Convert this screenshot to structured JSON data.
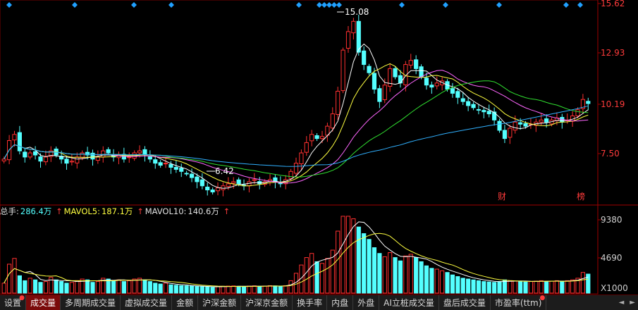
{
  "price_axis": {
    "labels": [
      "15.62",
      "12.93",
      "10.19",
      "7.50"
    ],
    "values": [
      15.62,
      12.93,
      10.19,
      7.5
    ]
  },
  "volume_axis": {
    "labels": [
      "9380",
      "4690",
      "X1000"
    ],
    "values": [
      9380,
      4690
    ]
  },
  "annotations": {
    "high": "15.08",
    "low": "6.42",
    "marker_cai": "财",
    "marker_bang": "榜"
  },
  "legend": {
    "total_label": "总手:",
    "total_value": "286.4万",
    "mavol5_label": "MAVOL5:",
    "mavol5_value": "187.1万",
    "mavol10_label": "MAVOL10:",
    "mavol10_value": "140.6万",
    "arrow": "↑"
  },
  "tabs": [
    {
      "label": "设置",
      "dot": true,
      "active": false
    },
    {
      "label": "成交量",
      "dot": false,
      "active": true
    },
    {
      "label": "多周期成交量",
      "dot": false,
      "active": false
    },
    {
      "label": "虚拟成交量",
      "dot": false,
      "active": false
    },
    {
      "label": "金额",
      "dot": false,
      "active": false
    },
    {
      "label": "沪深金额",
      "dot": false,
      "active": false
    },
    {
      "label": "沪深京金额",
      "dot": false,
      "active": false
    },
    {
      "label": "换手率",
      "dot": false,
      "active": false
    },
    {
      "label": "内盘",
      "dot": false,
      "active": false
    },
    {
      "label": "外盘",
      "dot": false,
      "active": false
    },
    {
      "label": "AI立桩成交量",
      "dot": false,
      "active": false
    },
    {
      "label": "盘后成交量",
      "dot": false,
      "active": false
    },
    {
      "label": "市盈率(ttm)",
      "dot": true,
      "active": false
    }
  ],
  "nav": {
    "left": "◄",
    "right": "►"
  },
  "colors": {
    "up": "#ff3030",
    "down": "#54ffff",
    "ma5": "#ffffff",
    "ma10": "#ffff40",
    "ma20": "#ff66ff",
    "ma30": "#30e030",
    "ma60": "#30b0ff",
    "marker": "#20a0ff"
  },
  "chart_data": {
    "type": "candlestick",
    "ohlc_closes": [
      8.2,
      9.1,
      9.4,
      8.6,
      8.3,
      8.5,
      8.4,
      8.1,
      8.3,
      8.6,
      8.4,
      8.2,
      8.0,
      8.1,
      8.3,
      8.5,
      8.4,
      8.2,
      8.3,
      8.6,
      8.5,
      8.3,
      8.4,
      8.2,
      8.3,
      8.5,
      8.6,
      8.4,
      8.2,
      8.0,
      7.9,
      8.0,
      7.8,
      7.7,
      7.6,
      7.5,
      7.3,
      7.1,
      6.9,
      6.7,
      6.6,
      6.8,
      6.9,
      7.0,
      7.1,
      7.0,
      6.9,
      7.1,
      7.2,
      7.0,
      7.1,
      7.2,
      7.1,
      7.0,
      7.2,
      7.6,
      8.0,
      8.5,
      9.0,
      9.4,
      9.2,
      9.3,
      9.8,
      10.4,
      11.5,
      13.5,
      14.4,
      14.9,
      13.4,
      12.8,
      12.4,
      11.6,
      11.0,
      11.8,
      12.6,
      12.2,
      11.9,
      12.8,
      13.0,
      12.6,
      12.2,
      11.8,
      11.7,
      11.9,
      12.0,
      11.6,
      11.4,
      11.2,
      11.0,
      10.8,
      10.7,
      10.6,
      10.5,
      10.4,
      10.1,
      9.6,
      9.2,
      9.7,
      10.0,
      9.9,
      9.8,
      9.9,
      10.0,
      10.1,
      10.0,
      10.1,
      10.2,
      10.0,
      10.1,
      10.3,
      10.6,
      11.1,
      10.9
    ],
    "volumes": [
      1200,
      3500,
      4200,
      2100,
      1500,
      1800,
      1600,
      1300,
      1400,
      1900,
      1600,
      1400,
      1200,
      1300,
      1500,
      1700,
      1600,
      1300,
      1400,
      1800,
      1700,
      1500,
      1600,
      1400,
      1500,
      1700,
      1800,
      1600,
      1400,
      1200,
      1100,
      1200,
      1000,
      950,
      900,
      880,
      850,
      800,
      780,
      760,
      700,
      800,
      820,
      850,
      870,
      820,
      800,
      850,
      880,
      820,
      850,
      900,
      870,
      830,
      900,
      1500,
      2400,
      3400,
      4300,
      4800,
      3800,
      3600,
      4200,
      5200,
      7500,
      9300,
      9300,
      9000,
      8000,
      7200,
      6500,
      5500,
      4800,
      4400,
      4900,
      4300,
      3900,
      4500,
      4700,
      4300,
      3800,
      3300,
      3000,
      2900,
      2700,
      2500,
      2200,
      2000,
      1800,
      1700,
      1600,
      1500,
      1400,
      1350,
      1300,
      1400,
      1600,
      1500,
      1450,
      1400,
      1350,
      1400,
      1450,
      1500,
      1400,
      1450,
      1500,
      1400,
      1500,
      1600,
      1800,
      2500,
      2300
    ],
    "ylim": [
      6.0,
      15.8
    ],
    "vol_ylim": [
      0,
      9380
    ]
  }
}
